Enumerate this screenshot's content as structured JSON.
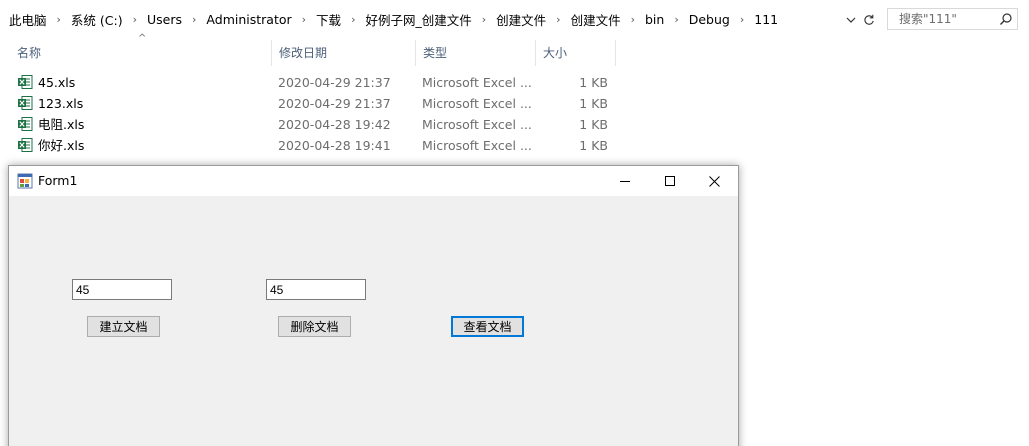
{
  "explorer": {
    "breadcrumbs": [
      "此电脑",
      "系统 (C:)",
      "Users",
      "Administrator",
      "下载",
      "好例子网_创建文件",
      "创建文件",
      "创建文件",
      "bin",
      "Debug",
      "111"
    ],
    "search_placeholder": "搜索\"111\"",
    "columns": {
      "name": "名称",
      "date": "修改日期",
      "type": "类型",
      "size": "大小"
    },
    "files": [
      {
        "name": "45.xls",
        "date": "2020-04-29 21:37",
        "type": "Microsoft Excel ...",
        "size": "1 KB"
      },
      {
        "name": "123.xls",
        "date": "2020-04-29 21:37",
        "type": "Microsoft Excel ...",
        "size": "1 KB"
      },
      {
        "name": "电阻.xls",
        "date": "2020-04-28 19:42",
        "type": "Microsoft Excel ...",
        "size": "1 KB"
      },
      {
        "name": "你好.xls",
        "date": "2020-04-28 19:41",
        "type": "Microsoft Excel ...",
        "size": "1 KB"
      }
    ]
  },
  "form1": {
    "title": "Form1",
    "textbox1_value": "45",
    "textbox2_value": "45",
    "create_button": "建立文档",
    "delete_button": "删除文档",
    "view_button": "查看文档"
  },
  "colors": {
    "accent": "#0078d7",
    "excel_green": "#1e7145",
    "column_header": "#4c607a"
  }
}
